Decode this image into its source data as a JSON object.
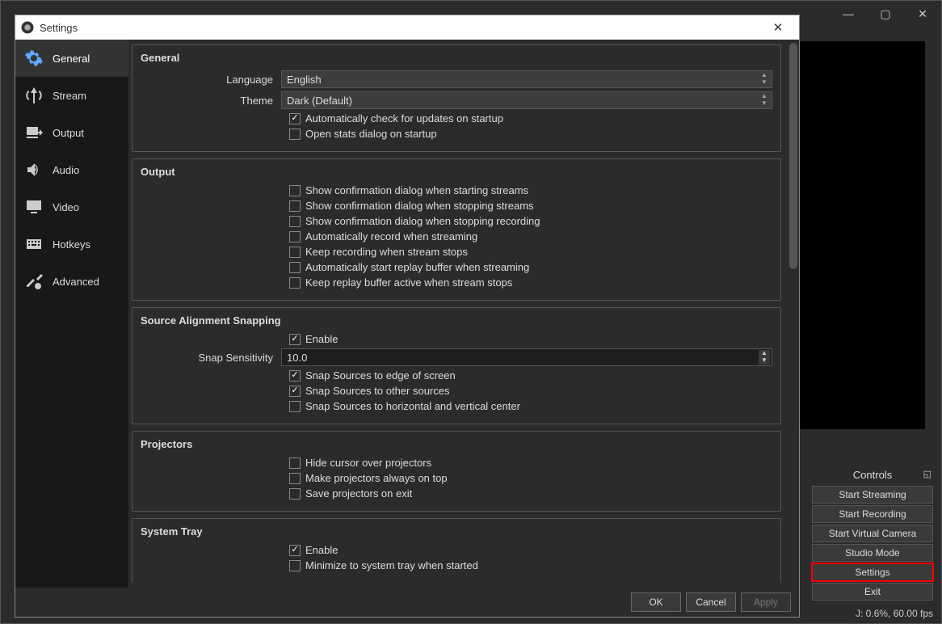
{
  "main_window": {
    "status": "J: 0.6%, 60.00 fps",
    "controls": {
      "title": "Controls",
      "buttons": [
        "Start Streaming",
        "Start Recording",
        "Start Virtual Camera",
        "Studio Mode",
        "Settings",
        "Exit"
      ],
      "highlighted_index": 4
    }
  },
  "dialog": {
    "title": "Settings",
    "sidebar": {
      "items": [
        "General",
        "Stream",
        "Output",
        "Audio",
        "Video",
        "Hotkeys",
        "Advanced"
      ],
      "selected": 0
    },
    "groups": {
      "general": {
        "title": "General",
        "language_label": "Language",
        "language_value": "English",
        "theme_label": "Theme",
        "theme_value": "Dark (Default)",
        "auto_update": {
          "label": "Automatically check for updates on startup",
          "checked": true
        },
        "open_stats": {
          "label": "Open stats dialog on startup",
          "checked": false
        }
      },
      "output": {
        "title": "Output",
        "confirm_start_stream": {
          "label": "Show confirmation dialog when starting streams",
          "checked": false
        },
        "confirm_stop_stream": {
          "label": "Show confirmation dialog when stopping streams",
          "checked": false
        },
        "confirm_stop_record": {
          "label": "Show confirmation dialog when stopping recording",
          "checked": false
        },
        "auto_record": {
          "label": "Automatically record when streaming",
          "checked": false
        },
        "keep_recording": {
          "label": "Keep recording when stream stops",
          "checked": false
        },
        "auto_replay": {
          "label": "Automatically start replay buffer when streaming",
          "checked": false
        },
        "keep_replay": {
          "label": "Keep replay buffer active when stream stops",
          "checked": false
        }
      },
      "snapping": {
        "title": "Source Alignment Snapping",
        "enable": {
          "label": "Enable",
          "checked": true
        },
        "sensitivity_label": "Snap Sensitivity",
        "sensitivity_value": "10.0",
        "snap_edge": {
          "label": "Snap Sources to edge of screen",
          "checked": true
        },
        "snap_sources": {
          "label": "Snap Sources to other sources",
          "checked": true
        },
        "snap_center": {
          "label": "Snap Sources to horizontal and vertical center",
          "checked": false
        }
      },
      "projectors": {
        "title": "Projectors",
        "hide_cursor": {
          "label": "Hide cursor over projectors",
          "checked": false
        },
        "always_top": {
          "label": "Make projectors always on top",
          "checked": false
        },
        "save_exit": {
          "label": "Save projectors on exit",
          "checked": false
        }
      },
      "tray": {
        "title": "System Tray",
        "enable": {
          "label": "Enable",
          "checked": true
        },
        "minimize": {
          "label": "Minimize to system tray when started",
          "checked": false
        }
      }
    },
    "buttons": {
      "ok": "OK",
      "cancel": "Cancel",
      "apply": "Apply"
    }
  }
}
